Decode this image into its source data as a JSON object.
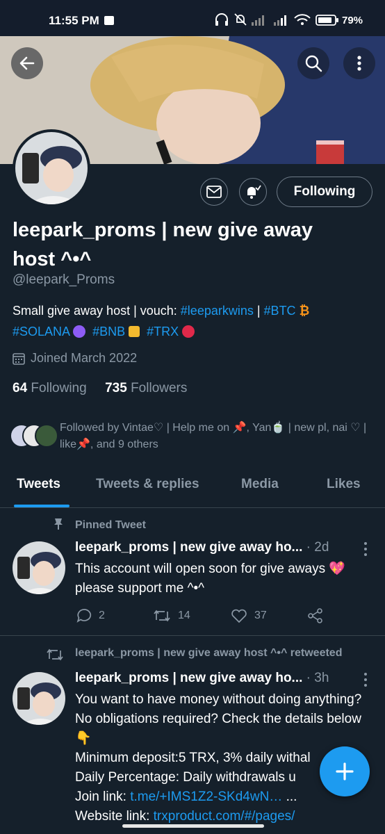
{
  "status_bar": {
    "time": "11:55 PM",
    "battery": "79%"
  },
  "profile": {
    "name": "leepark_proms | new give away host ^•^",
    "handle": "@leepark_Proms",
    "bio_prefix": "Small give away host | vouch: ",
    "bio_hashtag_1": "#leeparkwins",
    "bio_sep": " | ",
    "bio_hashtag_2": "#BTC",
    "bio_hashtag_3": "#SOLANA",
    "bio_hashtag_4": "#BNB",
    "bio_hashtag_5": "#TRX",
    "joined": "Joined March 2022",
    "following_count": "64",
    "following_label": "Following",
    "followers_count": "735",
    "followers_label": "Followers",
    "followed_by": "Followed by Vintae♡ | Help me on 📌, Yan🍵 | new pl, nai ♡ | like📌, and 9 others",
    "following_button": "Following"
  },
  "tabs": [
    "Tweets",
    "Tweets & replies",
    "Media",
    "Likes"
  ],
  "tweets": [
    {
      "context": "Pinned Tweet",
      "author": "leepark_proms | new give away ho...",
      "time": "· 2d",
      "text": "This account will open soon for give aways 💖 please support me ^•^",
      "replies": "2",
      "retweets": "14",
      "likes": "37"
    },
    {
      "context": "leepark_proms | new give away host ^•^ retweeted",
      "author": "leepark_proms | new give away ho...",
      "time": "· 3h",
      "line1": "You want to have money without doing anything? No obligations required? Check the details below 👇",
      "line2": "Minimum deposit:5 TRX, 3% daily with",
      "line2_tail": "al",
      "line3": "Daily Percentage: Daily withdrawals u",
      "line4_prefix": "Join link: ",
      "line4_link": "t.me/+IMS1Z2-SKd4wN…",
      "line4_suffix": " ...",
      "line5_prefix": "Website link: ",
      "line5_link": "trxproduct.com/#/pages/"
    }
  ],
  "colors": {
    "accent": "#1d9bf0",
    "background": "#15202b",
    "muted": "#8b98a5",
    "border": "#38444d"
  }
}
